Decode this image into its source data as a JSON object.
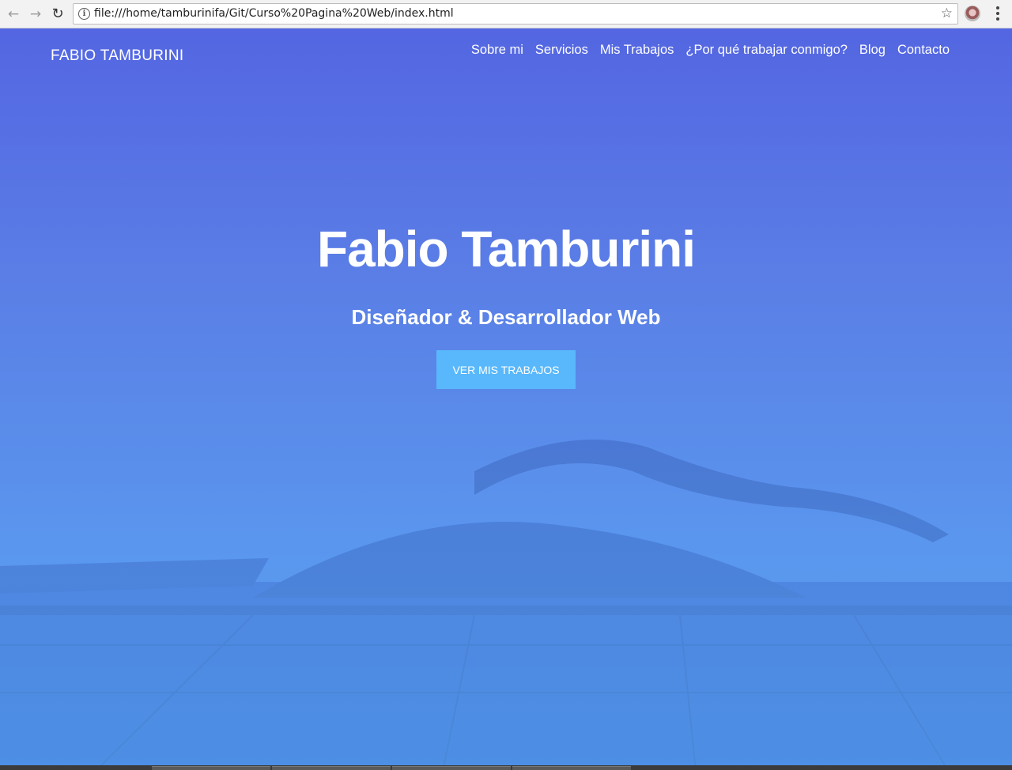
{
  "browser": {
    "url": "file:///home/tamburinifa/Git/Curso%20Pagina%20Web/index.html",
    "back_icon": "arrow-left-icon",
    "forward_icon": "arrow-right-icon",
    "reload_icon": "reload-icon",
    "info_icon": "info-icon",
    "bookmark_icon": "star-icon",
    "menu_icon": "kebab-menu-icon"
  },
  "site": {
    "brand": "FABIO TAMBURINI",
    "nav": [
      "Sobre mi",
      "Servicios",
      "Mis Trabajos",
      "¿Por qué trabajar conmigo?",
      "Blog",
      "Contacto"
    ],
    "hero_title": "Fabio Tamburini",
    "hero_subtitle": "Diseñador & Desarrollador Web",
    "cta_label": "VER MIS TRABAJOS"
  },
  "colors": {
    "hero_top": "#5466e2",
    "hero_bottom": "#58a2f1",
    "cta": "#59b8fb"
  }
}
